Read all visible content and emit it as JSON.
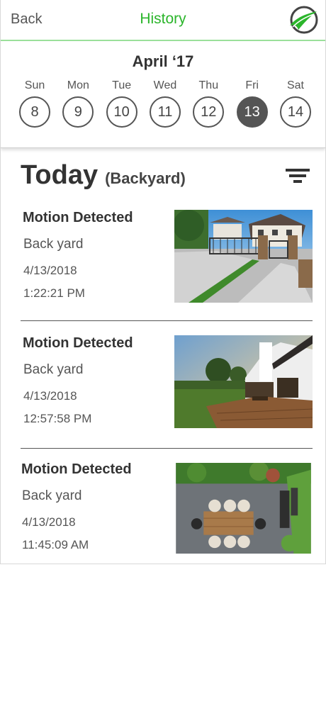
{
  "header": {
    "back_label": "Back",
    "title": "History"
  },
  "calendar": {
    "month": "April ‘17",
    "days": [
      {
        "name": "Sun",
        "num": "8"
      },
      {
        "name": "Mon",
        "num": "9"
      },
      {
        "name": "Tue",
        "num": "10"
      },
      {
        "name": "Wed",
        "num": "11"
      },
      {
        "name": "Thu",
        "num": "12"
      },
      {
        "name": "Fri",
        "num": "13"
      },
      {
        "name": "Sat",
        "num": "14"
      }
    ],
    "selected_index": 5
  },
  "section": {
    "heading": "Today",
    "location": "(Backyard)"
  },
  "events": [
    {
      "title": "Motion Detected",
      "location": "Back yard",
      "date": "4/13/2018",
      "time": "1:22:21 PM"
    },
    {
      "title": "Motion Detected",
      "location": "Back yard",
      "date": "4/13/2018",
      "time": "12:57:58 PM"
    },
    {
      "title": "Motion Detected",
      "location": "Back yard",
      "date": "4/13/2018",
      "time": "11:45:09 AM"
    }
  ],
  "colors": {
    "accent": "#2bb52b",
    "selected_day": "#555555"
  }
}
